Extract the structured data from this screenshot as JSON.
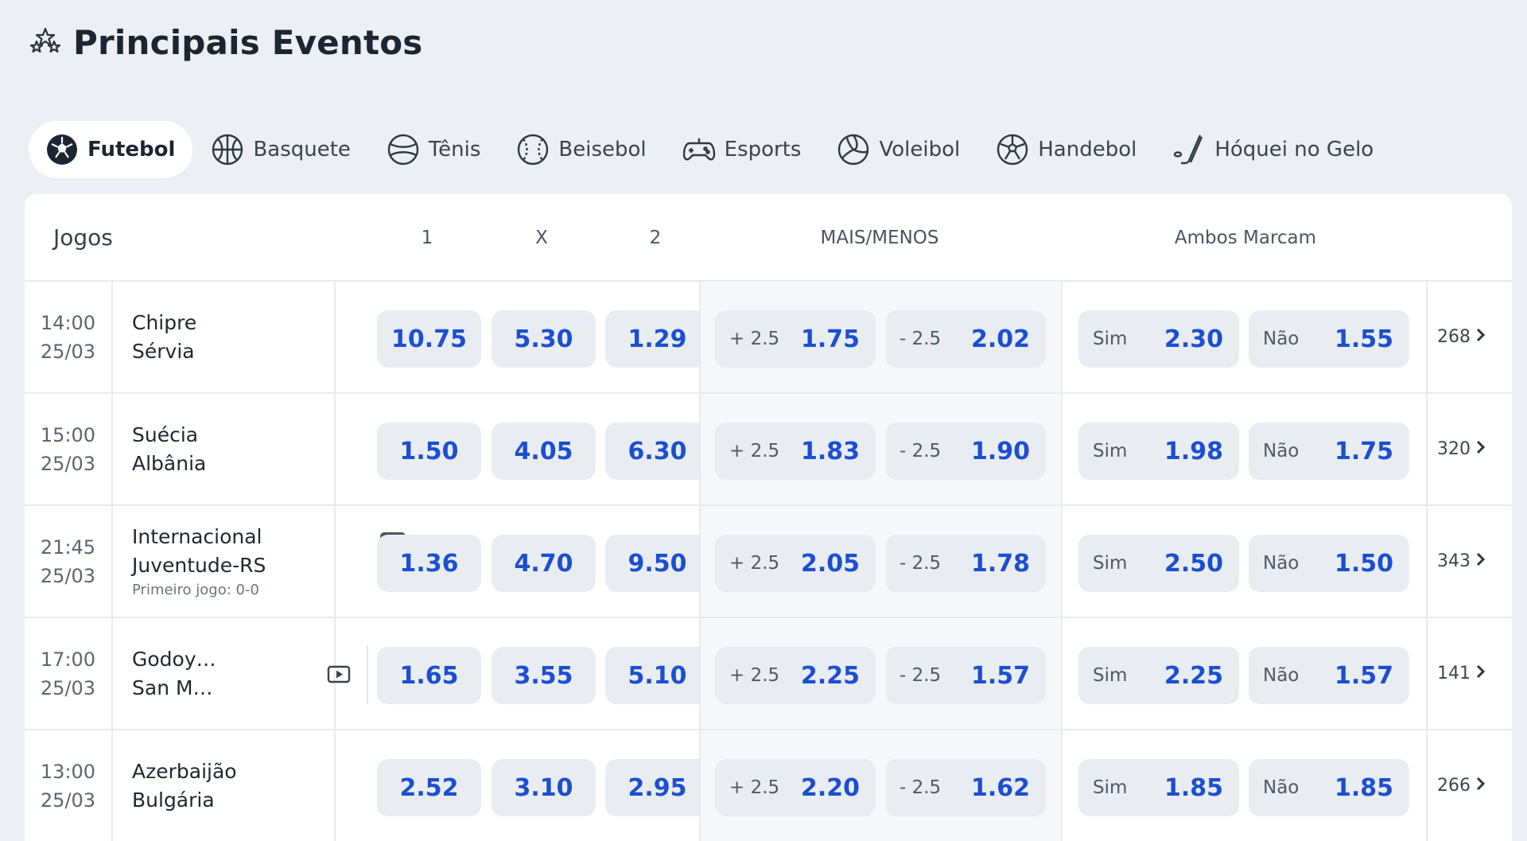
{
  "page": {
    "title": "Principais Eventos"
  },
  "sports": [
    {
      "label": "Futebol",
      "icon": "soccer-ball-icon",
      "active": true
    },
    {
      "label": "Basquete",
      "icon": "basketball-icon"
    },
    {
      "label": "Tênis",
      "icon": "tennis-ball-icon"
    },
    {
      "label": "Beisebol",
      "icon": "baseball-icon"
    },
    {
      "label": "Esports",
      "icon": "gamepad-icon"
    },
    {
      "label": "Voleibol",
      "icon": "volleyball-icon"
    },
    {
      "label": "Handebol",
      "icon": "handball-icon"
    },
    {
      "label": "Hóquei no Gelo",
      "icon": "hockey-stick-icon"
    }
  ],
  "table": {
    "headers": {
      "games": "Jogos",
      "home": "1",
      "draw": "X",
      "away": "2",
      "over_under": "MAIS/MENOS",
      "both_score": "Ambos Marcam"
    },
    "rows": [
      {
        "time": "14:00",
        "date": "25/03",
        "home": "Chipre",
        "away": "Sérvia",
        "note": "",
        "has_video": false,
        "odds": [
          "10.75",
          "5.30",
          "1.29"
        ],
        "over": {
          "label": "+ 2.5",
          "value": "1.75"
        },
        "under": {
          "label": "- 2.5",
          "value": "2.02"
        },
        "yes": {
          "label": "Sim",
          "value": "2.30"
        },
        "no": {
          "label": "Não",
          "value": "1.55"
        },
        "more": "268"
      },
      {
        "time": "15:00",
        "date": "25/03",
        "home": "Suécia",
        "away": "Albânia",
        "note": "",
        "has_video": false,
        "odds": [
          "1.50",
          "4.05",
          "6.30"
        ],
        "over": {
          "label": "+ 2.5",
          "value": "1.83"
        },
        "under": {
          "label": "- 2.5",
          "value": "1.90"
        },
        "yes": {
          "label": "Sim",
          "value": "1.98"
        },
        "no": {
          "label": "Não",
          "value": "1.75"
        },
        "more": "320"
      },
      {
        "time": "21:45",
        "date": "25/03",
        "home": "Internacional",
        "away": "Juventude-RS",
        "note": "Primeiro jogo: 0-0",
        "has_video": false,
        "odds": [
          "1.36",
          "4.70",
          "9.50"
        ],
        "over": {
          "label": "+ 2.5",
          "value": "2.05"
        },
        "under": {
          "label": "- 2.5",
          "value": "1.78"
        },
        "yes": {
          "label": "Sim",
          "value": "2.50"
        },
        "no": {
          "label": "Não",
          "value": "1.50"
        },
        "more": "343"
      },
      {
        "time": "17:00",
        "date": "25/03",
        "home": "Godoy…",
        "away": "San M…",
        "note": "",
        "has_video": true,
        "odds": [
          "1.65",
          "3.55",
          "5.10"
        ],
        "over": {
          "label": "+ 2.5",
          "value": "2.25"
        },
        "under": {
          "label": "- 2.5",
          "value": "1.57"
        },
        "yes": {
          "label": "Sim",
          "value": "2.25"
        },
        "no": {
          "label": "Não",
          "value": "1.57"
        },
        "more": "141"
      },
      {
        "time": "13:00",
        "date": "25/03",
        "home": "Azerbaijão",
        "away": "Bulgária",
        "note": "",
        "has_video": false,
        "odds": [
          "2.52",
          "3.10",
          "2.95"
        ],
        "over": {
          "label": "+ 2.5",
          "value": "2.20"
        },
        "under": {
          "label": "- 2.5",
          "value": "1.62"
        },
        "yes": {
          "label": "Sim",
          "value": "1.85"
        },
        "no": {
          "label": "Não",
          "value": "1.85"
        },
        "more": "266"
      }
    ]
  },
  "colors": {
    "odds_text": "#1b4fd1",
    "odd_button_bg": "#e9ecf1",
    "page_bg": "#eceff3"
  }
}
